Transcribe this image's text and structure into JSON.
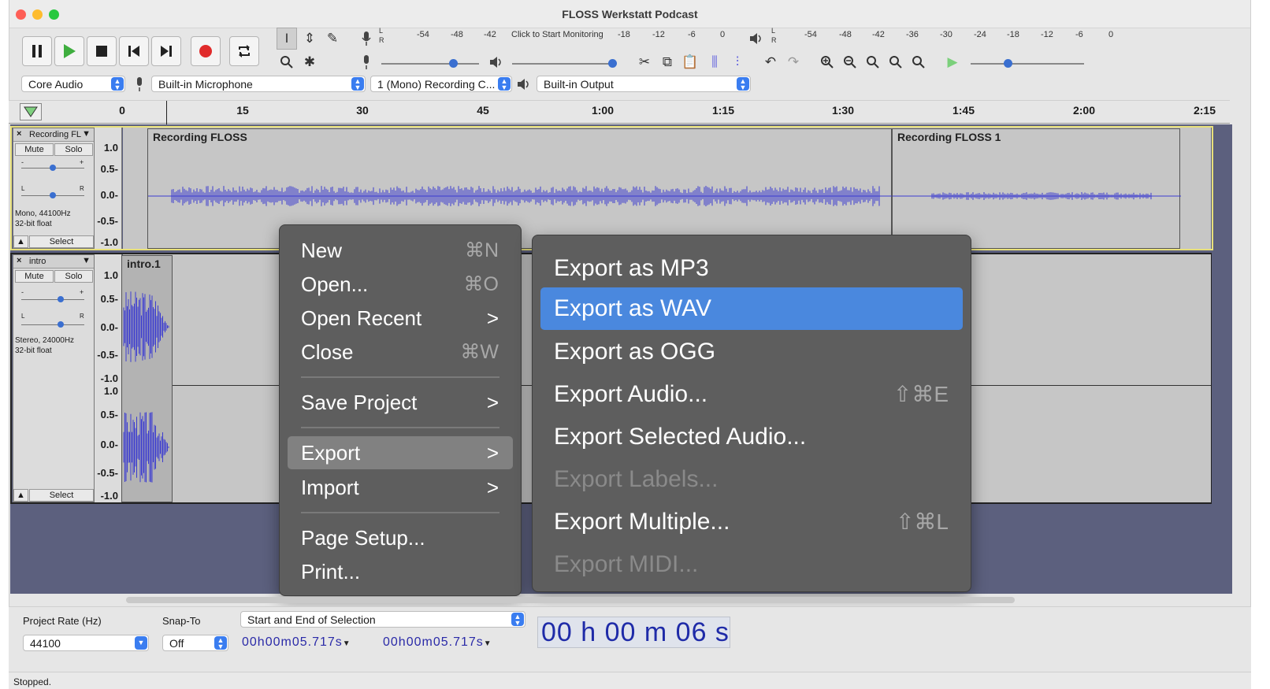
{
  "window": {
    "title": "FLOSS Werkstatt Podcast"
  },
  "meters": {
    "record_scale": [
      "-54",
      "-48",
      "-42",
      "Click to Start Monitoring",
      "-18",
      "-12",
      "-6",
      "0"
    ],
    "play_scale": [
      "-54",
      "-48",
      "-42",
      "-36",
      "-30",
      "-24",
      "-18",
      "-12",
      "-6",
      "0"
    ],
    "lr": [
      "L",
      "R"
    ]
  },
  "devices": {
    "host": "Core Audio",
    "input": "Built-in Microphone",
    "channels": "1 (Mono) Recording C...",
    "output": "Built-in Output"
  },
  "ruler": {
    "ticks": [
      "0",
      "15",
      "30",
      "45",
      "1:00",
      "1:15",
      "1:30",
      "1:45",
      "2:00",
      "2:15"
    ]
  },
  "tracks": [
    {
      "name": "Recording FL",
      "mute": "Mute",
      "solo": "Solo",
      "gain_minus": "-",
      "gain_plus": "+",
      "pan_l": "L",
      "pan_r": "R",
      "info1": "Mono, 44100Hz",
      "info2": "32-bit float",
      "select": "Select",
      "scale": [
        "1.0",
        "0.5-",
        "0.0-",
        "-0.5-",
        "-1.0"
      ],
      "clips": [
        "Recording FLOSS",
        "Recording FLOSS 1"
      ]
    },
    {
      "name": "intro",
      "mute": "Mute",
      "solo": "Solo",
      "gain_minus": "-",
      "gain_plus": "+",
      "pan_l": "L",
      "pan_r": "R",
      "info1": "Stereo, 24000Hz",
      "info2": "32-bit float",
      "select": "Select",
      "scale": [
        "1.0",
        "0.5-",
        "0.0-",
        "-0.5-",
        "-1.0"
      ],
      "scale2": [
        "1.0",
        "0.5-",
        "0.0-",
        "-0.5-",
        "-1.0"
      ],
      "clips": [
        "intro.1"
      ]
    }
  ],
  "file_menu": [
    {
      "label": "New",
      "shortcut": "⌘N"
    },
    {
      "label": "Open...",
      "shortcut": "⌘O"
    },
    {
      "label": "Open Recent",
      "arrow": ">"
    },
    {
      "label": "Close",
      "shortcut": "⌘W"
    },
    {
      "label": "Save Project",
      "arrow": ">"
    },
    {
      "label": "Export",
      "arrow": ">"
    },
    {
      "label": "Import",
      "arrow": ">"
    },
    {
      "label": "Page Setup..."
    },
    {
      "label": "Print..."
    }
  ],
  "export_menu": [
    {
      "label": "Export as MP3"
    },
    {
      "label": "Export as WAV"
    },
    {
      "label": "Export as OGG"
    },
    {
      "label": "Export Audio...",
      "shortcut": "⇧⌘E"
    },
    {
      "label": "Export Selected Audio..."
    },
    {
      "label": "Export Labels..."
    },
    {
      "label": "Export Multiple...",
      "shortcut": "⇧⌘L"
    },
    {
      "label": "Export MIDI..."
    }
  ],
  "bottom": {
    "rate_label": "Project Rate (Hz)",
    "rate_value": "44100",
    "snap_label": "Snap-To",
    "snap_value": "Off",
    "selection_mode": "Start and End of Selection",
    "start_time": "00h00m05.717s",
    "end_time": "00h00m05.717s",
    "position": "00 h 00 m 06 s",
    "status": "Stopped."
  },
  "colors": {
    "accent": "#4a88de",
    "waveform": "#3c3cd0",
    "track_bg": "#5c607e"
  }
}
